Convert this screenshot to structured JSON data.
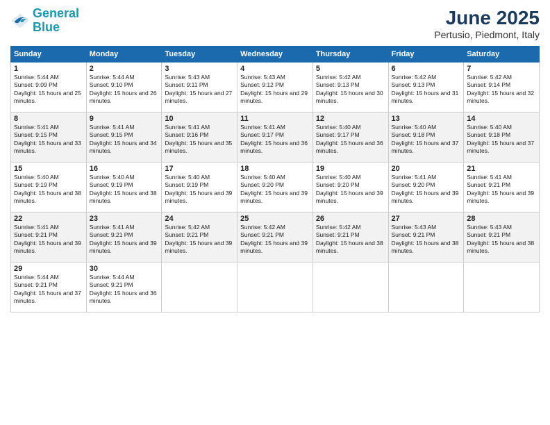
{
  "logo": {
    "line1": "General",
    "line2": "Blue"
  },
  "title": "June 2025",
  "subtitle": "Pertusio, Piedmont, Italy",
  "headers": [
    "Sunday",
    "Monday",
    "Tuesday",
    "Wednesday",
    "Thursday",
    "Friday",
    "Saturday"
  ],
  "weeks": [
    [
      {
        "day": "1",
        "sunrise": "Sunrise: 5:44 AM",
        "sunset": "Sunset: 9:09 PM",
        "daylight": "Daylight: 15 hours and 25 minutes."
      },
      {
        "day": "2",
        "sunrise": "Sunrise: 5:44 AM",
        "sunset": "Sunset: 9:10 PM",
        "daylight": "Daylight: 15 hours and 26 minutes."
      },
      {
        "day": "3",
        "sunrise": "Sunrise: 5:43 AM",
        "sunset": "Sunset: 9:11 PM",
        "daylight": "Daylight: 15 hours and 27 minutes."
      },
      {
        "day": "4",
        "sunrise": "Sunrise: 5:43 AM",
        "sunset": "Sunset: 9:12 PM",
        "daylight": "Daylight: 15 hours and 29 minutes."
      },
      {
        "day": "5",
        "sunrise": "Sunrise: 5:42 AM",
        "sunset": "Sunset: 9:13 PM",
        "daylight": "Daylight: 15 hours and 30 minutes."
      },
      {
        "day": "6",
        "sunrise": "Sunrise: 5:42 AM",
        "sunset": "Sunset: 9:13 PM",
        "daylight": "Daylight: 15 hours and 31 minutes."
      },
      {
        "day": "7",
        "sunrise": "Sunrise: 5:42 AM",
        "sunset": "Sunset: 9:14 PM",
        "daylight": "Daylight: 15 hours and 32 minutes."
      }
    ],
    [
      {
        "day": "8",
        "sunrise": "Sunrise: 5:41 AM",
        "sunset": "Sunset: 9:15 PM",
        "daylight": "Daylight: 15 hours and 33 minutes."
      },
      {
        "day": "9",
        "sunrise": "Sunrise: 5:41 AM",
        "sunset": "Sunset: 9:15 PM",
        "daylight": "Daylight: 15 hours and 34 minutes."
      },
      {
        "day": "10",
        "sunrise": "Sunrise: 5:41 AM",
        "sunset": "Sunset: 9:16 PM",
        "daylight": "Daylight: 15 hours and 35 minutes."
      },
      {
        "day": "11",
        "sunrise": "Sunrise: 5:41 AM",
        "sunset": "Sunset: 9:17 PM",
        "daylight": "Daylight: 15 hours and 36 minutes."
      },
      {
        "day": "12",
        "sunrise": "Sunrise: 5:40 AM",
        "sunset": "Sunset: 9:17 PM",
        "daylight": "Daylight: 15 hours and 36 minutes."
      },
      {
        "day": "13",
        "sunrise": "Sunrise: 5:40 AM",
        "sunset": "Sunset: 9:18 PM",
        "daylight": "Daylight: 15 hours and 37 minutes."
      },
      {
        "day": "14",
        "sunrise": "Sunrise: 5:40 AM",
        "sunset": "Sunset: 9:18 PM",
        "daylight": "Daylight: 15 hours and 37 minutes."
      }
    ],
    [
      {
        "day": "15",
        "sunrise": "Sunrise: 5:40 AM",
        "sunset": "Sunset: 9:19 PM",
        "daylight": "Daylight: 15 hours and 38 minutes."
      },
      {
        "day": "16",
        "sunrise": "Sunrise: 5:40 AM",
        "sunset": "Sunset: 9:19 PM",
        "daylight": "Daylight: 15 hours and 38 minutes."
      },
      {
        "day": "17",
        "sunrise": "Sunrise: 5:40 AM",
        "sunset": "Sunset: 9:19 PM",
        "daylight": "Daylight: 15 hours and 39 minutes."
      },
      {
        "day": "18",
        "sunrise": "Sunrise: 5:40 AM",
        "sunset": "Sunset: 9:20 PM",
        "daylight": "Daylight: 15 hours and 39 minutes."
      },
      {
        "day": "19",
        "sunrise": "Sunrise: 5:40 AM",
        "sunset": "Sunset: 9:20 PM",
        "daylight": "Daylight: 15 hours and 39 minutes."
      },
      {
        "day": "20",
        "sunrise": "Sunrise: 5:41 AM",
        "sunset": "Sunset: 9:20 PM",
        "daylight": "Daylight: 15 hours and 39 minutes."
      },
      {
        "day": "21",
        "sunrise": "Sunrise: 5:41 AM",
        "sunset": "Sunset: 9:21 PM",
        "daylight": "Daylight: 15 hours and 39 minutes."
      }
    ],
    [
      {
        "day": "22",
        "sunrise": "Sunrise: 5:41 AM",
        "sunset": "Sunset: 9:21 PM",
        "daylight": "Daylight: 15 hours and 39 minutes."
      },
      {
        "day": "23",
        "sunrise": "Sunrise: 5:41 AM",
        "sunset": "Sunset: 9:21 PM",
        "daylight": "Daylight: 15 hours and 39 minutes."
      },
      {
        "day": "24",
        "sunrise": "Sunrise: 5:42 AM",
        "sunset": "Sunset: 9:21 PM",
        "daylight": "Daylight: 15 hours and 39 minutes."
      },
      {
        "day": "25",
        "sunrise": "Sunrise: 5:42 AM",
        "sunset": "Sunset: 9:21 PM",
        "daylight": "Daylight: 15 hours and 39 minutes."
      },
      {
        "day": "26",
        "sunrise": "Sunrise: 5:42 AM",
        "sunset": "Sunset: 9:21 PM",
        "daylight": "Daylight: 15 hours and 38 minutes."
      },
      {
        "day": "27",
        "sunrise": "Sunrise: 5:43 AM",
        "sunset": "Sunset: 9:21 PM",
        "daylight": "Daylight: 15 hours and 38 minutes."
      },
      {
        "day": "28",
        "sunrise": "Sunrise: 5:43 AM",
        "sunset": "Sunset: 9:21 PM",
        "daylight": "Daylight: 15 hours and 38 minutes."
      }
    ],
    [
      {
        "day": "29",
        "sunrise": "Sunrise: 5:44 AM",
        "sunset": "Sunset: 9:21 PM",
        "daylight": "Daylight: 15 hours and 37 minutes."
      },
      {
        "day": "30",
        "sunrise": "Sunrise: 5:44 AM",
        "sunset": "Sunset: 9:21 PM",
        "daylight": "Daylight: 15 hours and 36 minutes."
      },
      null,
      null,
      null,
      null,
      null
    ]
  ]
}
